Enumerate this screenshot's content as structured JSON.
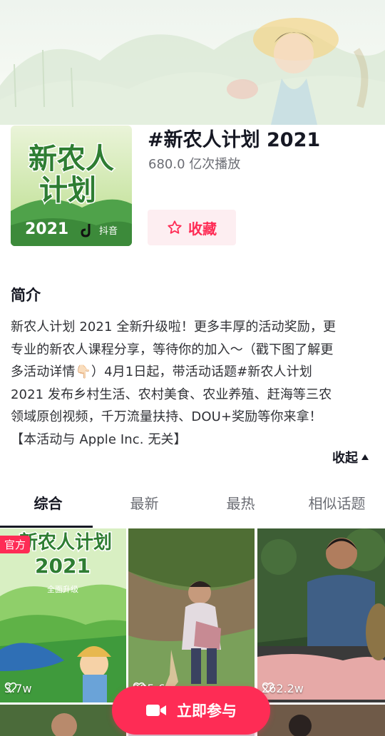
{
  "header": {
    "title": "#新农人计划 2021",
    "play_count": "680.0 亿次播放",
    "favorite_label": "收藏",
    "cover_line1": "新农人",
    "cover_line2": "计划",
    "cover_year": "2021",
    "cover_brand": "抖音"
  },
  "intro": {
    "heading": "简介",
    "lines": [
      "新农人计划 2021 全新升级啦！更多丰厚的活动奖励，更",
      "专业的新农人课程分享，等待你的加入～（戳下图了解更",
      "多活动详情👇🏻）4月1日起，带活动话题#新农人计划",
      "2021 发布乡村生活、农村美食、农业养殖、赶海等三农",
      "领域原创视频，千万流量扶持、DOU+奖励等你来拿！",
      "【本活动与 Apple Inc. 无关】"
    ],
    "collapse_label": "收起"
  },
  "tabs": [
    "综合",
    "最新",
    "最热",
    "相似话题"
  ],
  "videos": [
    {
      "likes": "3.7w",
      "badge": "官方",
      "title_line": "新农人计划",
      "year": "2021",
      "subtitle": "全面升级"
    },
    {
      "likes": "285.6w"
    },
    {
      "likes": "262.2w"
    }
  ],
  "join_label": "立即参与",
  "colors": {
    "accent": "#fe2c55",
    "text": "#161823",
    "secondary": "#6b6d74"
  }
}
